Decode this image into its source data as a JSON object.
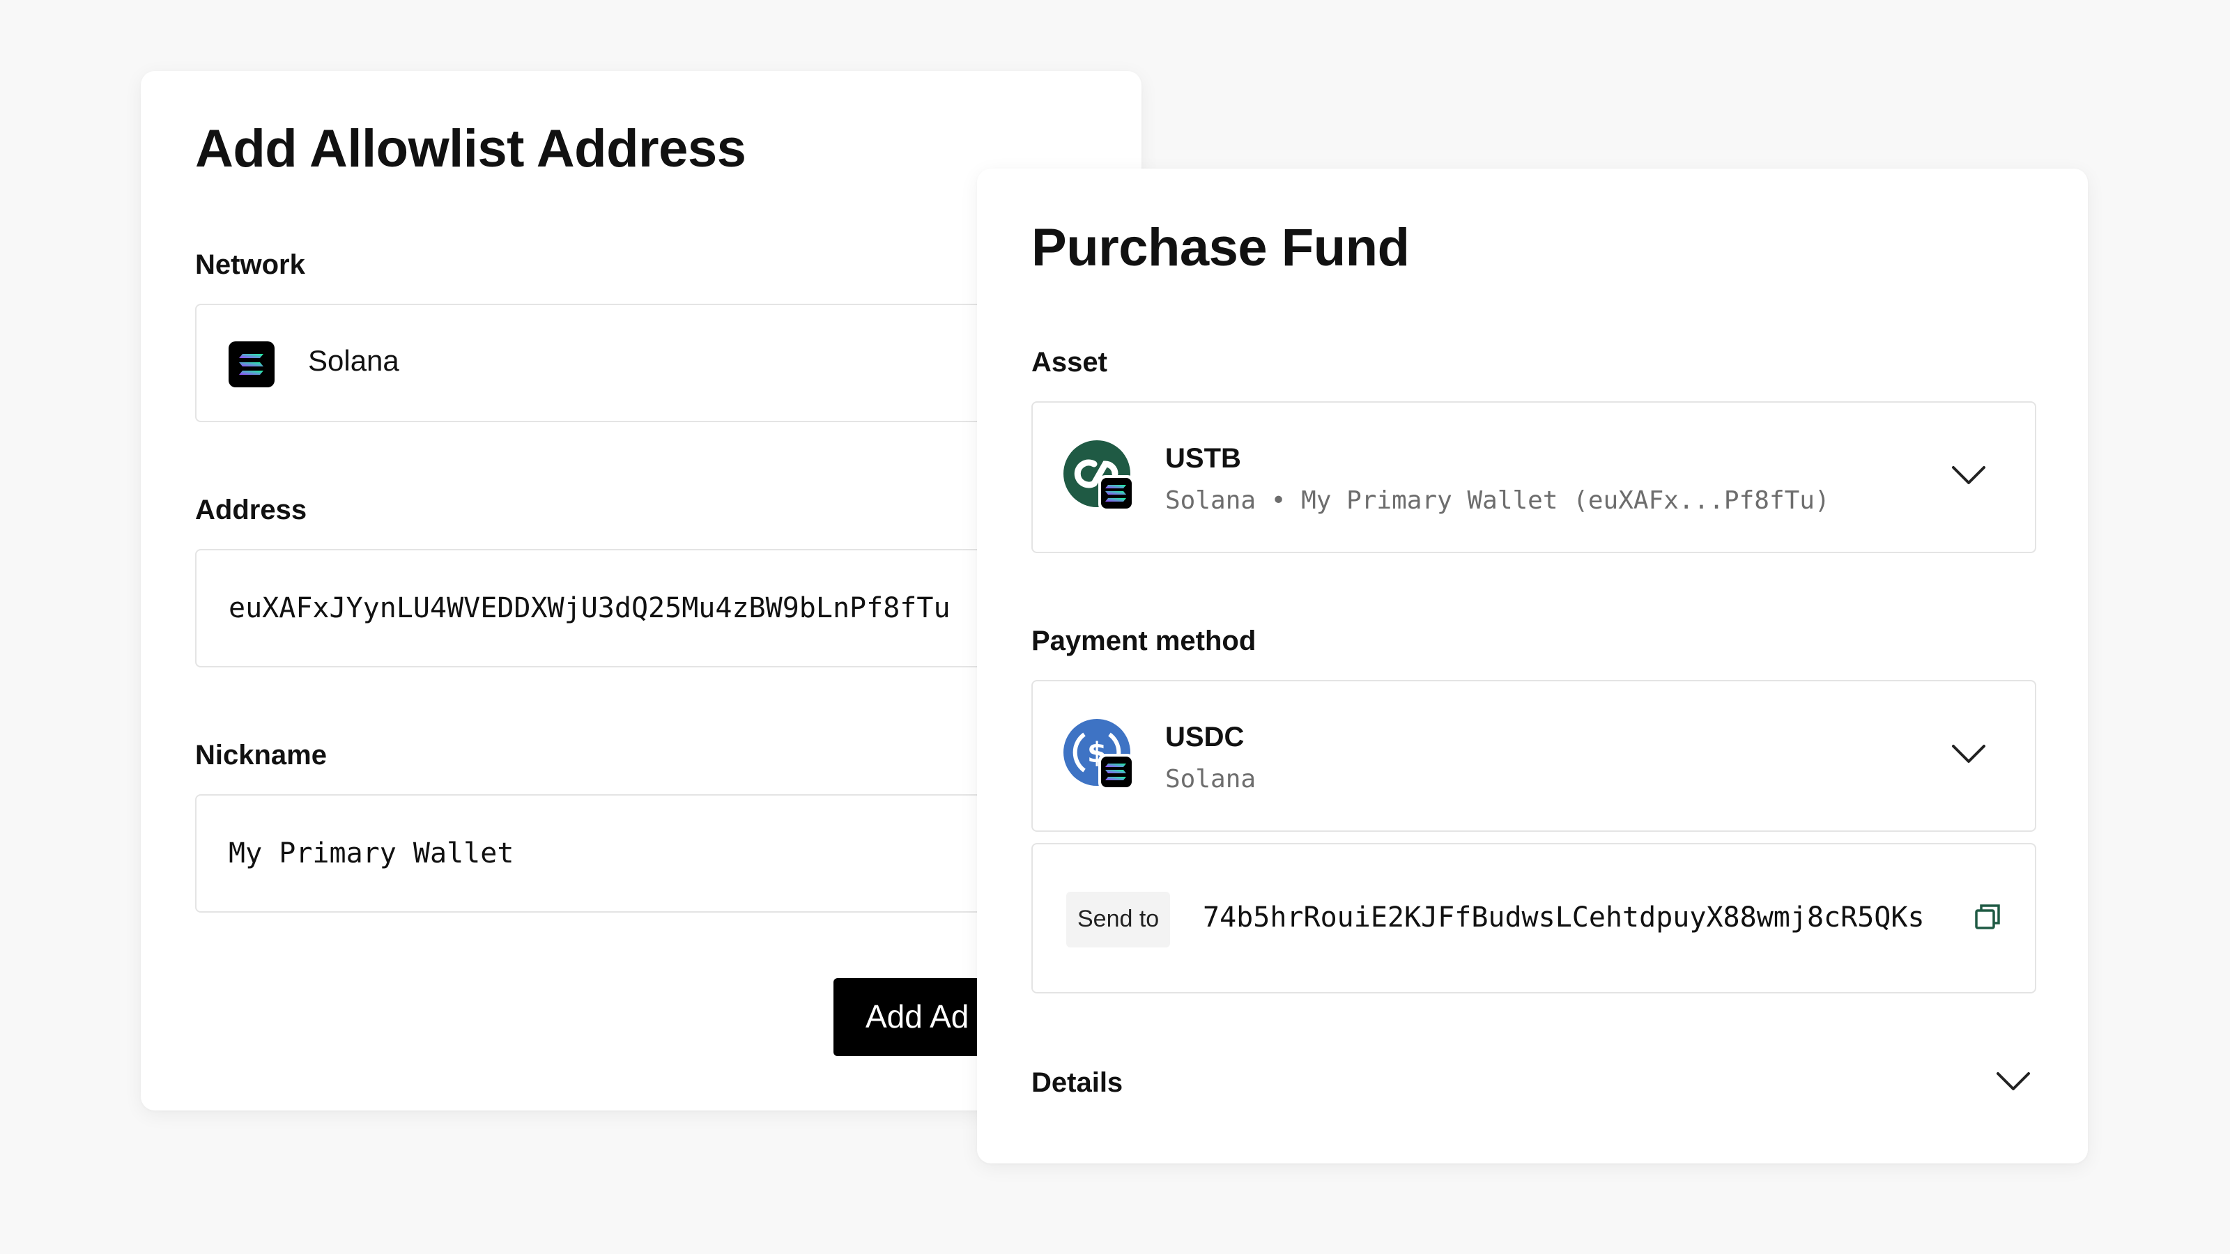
{
  "left_card": {
    "title": "Add Allowlist Address",
    "network_label": "Network",
    "network_value": "Solana",
    "address_label": "Address",
    "address_value": "euXAFxJYynLU4WVEDDXWjU3dQ25Mu4zBW9bLnPf8fTu",
    "nickname_label": "Nickname",
    "nickname_value": "My Primary Wallet",
    "add_button_label": "Add Ad"
  },
  "right_card": {
    "title": "Purchase Fund",
    "asset_label": "Asset",
    "asset": {
      "name": "USTB",
      "subtitle": "Solana • My Primary Wallet (euXAFx...Pf8fTu)",
      "icon": "ustb-coin-icon"
    },
    "payment_label": "Payment method",
    "payment": {
      "name": "USDC",
      "subtitle": "Solana",
      "icon": "usdc-coin-icon"
    },
    "send_to_label": "Send to",
    "send_to_address": "74b5hrRouiE2KJFfBudwsLCehtdpuyX88wmj8cR5QKs",
    "details_label": "Details"
  },
  "colors": {
    "ustb_green": "#1f5a44",
    "usdc_blue": "#3e73c4",
    "sol_gradient_start": "#19fb9b",
    "sol_gradient_end": "#9945ff",
    "button_bg": "#000000"
  }
}
